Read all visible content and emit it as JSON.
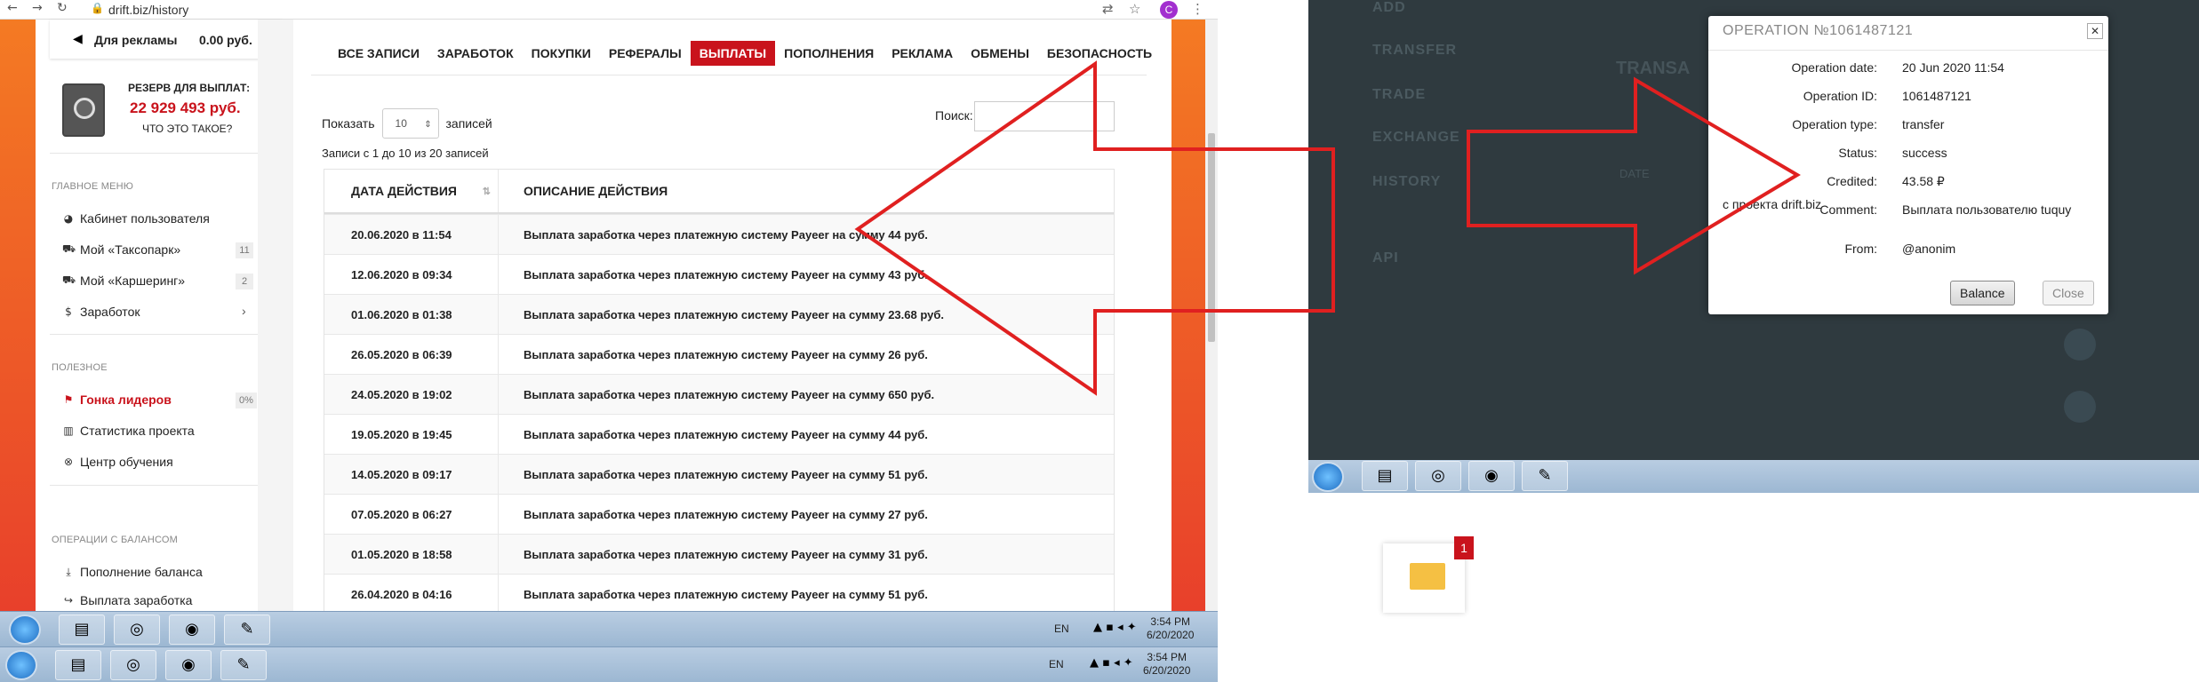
{
  "browser": {
    "url": "drift.biz/history"
  },
  "sidebar": {
    "ads_label": "Для рекламы",
    "ads_value": "0.00 руб.",
    "reserve_label": "РЕЗЕРВ ДЛЯ ВЫПЛАТ:",
    "reserve_value": "22 929 493 руб.",
    "whats_this": "ЧТО ЭТО ТАКОЕ?",
    "main_menu_title": "ГЛАВНОЕ МЕНЮ",
    "main_menu": [
      {
        "label": "Кабинет пользователя",
        "icon": "dashboard-icon",
        "count": ""
      },
      {
        "label": "Мой «Таксопарк»",
        "icon": "car-icon",
        "count": "11"
      },
      {
        "label": "Мой «Каршеринг»",
        "icon": "truck-icon",
        "count": "2"
      },
      {
        "label": "Заработок",
        "icon": "money-bag-icon",
        "count": ""
      }
    ],
    "useful_title": "ПОЛЕЗНОЕ",
    "useful": [
      {
        "label": "Гонка лидеров",
        "icon": "flag-icon",
        "count": "0%"
      },
      {
        "label": "Статистика проекта",
        "icon": "chart-icon",
        "count": ""
      },
      {
        "label": "Центр обучения",
        "icon": "lifebuoy-icon",
        "count": ""
      }
    ],
    "balance_title": "ОПЕРАЦИИ С БАЛАНСОМ",
    "balance": [
      {
        "label": "Пополнение баланса",
        "icon": "download-icon"
      },
      {
        "label": "Выплата заработка",
        "icon": "logout-icon"
      }
    ]
  },
  "tabs": [
    "ВСЕ ЗАПИСИ",
    "ЗАРАБОТОК",
    "ПОКУПКИ",
    "РЕФЕРАЛЫ",
    "ВЫПЛАТЫ",
    "ПОПОЛНЕНИЯ",
    "РЕКЛАМА",
    "ОБМЕНЫ",
    "БЕЗОПАСНОСТЬ"
  ],
  "active_tab": "ВЫПЛАТЫ",
  "table_controls": {
    "show_label": "Показать",
    "show_value": "10",
    "show_suffix": "записей",
    "search_label": "Поиск:",
    "records_info": "Записи с 1 до 10 из 20 записей"
  },
  "table": {
    "headers": [
      "ДАТА ДЕЙСТВИЯ",
      "ОПИСАНИЕ ДЕЙСТВИЯ"
    ],
    "rows": [
      [
        "20.06.2020 в 11:54",
        "Выплата заработка через платежную систему Payeer на сумму 44 руб."
      ],
      [
        "12.06.2020 в 09:34",
        "Выплата заработка через платежную систему Payeer на сумму 43 руб."
      ],
      [
        "01.06.2020 в 01:38",
        "Выплата заработка через платежную систему Payeer на сумму 23.68 руб."
      ],
      [
        "26.05.2020 в 06:39",
        "Выплата заработка через платежную систему Payeer на сумму 26 руб."
      ],
      [
        "24.05.2020 в 19:02",
        "Выплата заработка через платежную систему Payeer на сумму 650 руб."
      ],
      [
        "19.05.2020 в 19:45",
        "Выплата заработка через платежную систему Payeer на сумму 44 руб."
      ],
      [
        "14.05.2020 в 09:17",
        "Выплата заработка через платежную систему Payeer на сумму 51 руб."
      ],
      [
        "07.05.2020 в 06:27",
        "Выплата заработка через платежную систему Payeer на сумму 27 руб."
      ],
      [
        "01.05.2020 в 18:58",
        "Выплата заработка через платежную систему Payeer на сумму 31 руб."
      ],
      [
        "26.04.2020 в 04:16",
        "Выплата заработка через платежную систему Payeer на сумму 51 руб."
      ]
    ]
  },
  "mail_badge": "1",
  "taskbar": {
    "lang": "EN",
    "time": "3:54 PM",
    "date": "6/20/2020"
  },
  "right_menu": [
    "ADD",
    "TRANSFER",
    "TRADE",
    "EXCHANGE",
    "HISTORY",
    "API"
  ],
  "right_header": "TRANSA",
  "right_col": "DATE",
  "modal": {
    "title": "OPERATION №1061487121",
    "fields": [
      {
        "label": "Operation date:",
        "value": "20 Jun 2020 11:54"
      },
      {
        "label": "Operation ID:",
        "value": "1061487121"
      },
      {
        "label": "Operation type:",
        "value": "transfer"
      },
      {
        "label": "Status:",
        "value": "success"
      },
      {
        "label": "Credited:",
        "value": "43.58 ₽"
      },
      {
        "label": "Comment:",
        "value": "Выплата пользователю tuquy"
      }
    ],
    "comment_cont": "с проекта drift.biz",
    "from_label": "From:",
    "from_value": "@anonim",
    "balance_btn": "Balance",
    "close_btn": "Close"
  },
  "colors": {
    "accent": "#c9131c",
    "orange": "#f47a23",
    "arrow": "#e02020",
    "dark_bg": "#2f3a3f"
  }
}
